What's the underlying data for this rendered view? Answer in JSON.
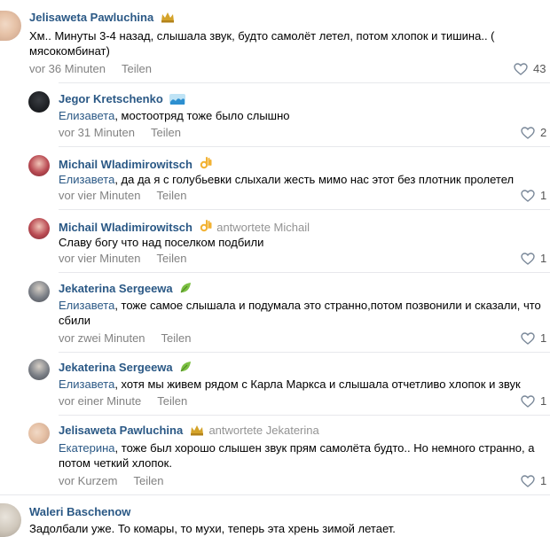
{
  "comments": [
    {
      "author": "Jelisaweta Pawluchina",
      "badge_icon": "crown-icon",
      "text": "Хм.. Минуты 3-4 назад, слышала звук, будто самолёт летел, потом хлопок и тишина.. ( мясокомбинат)",
      "time": "vor 36 Minuten",
      "share": "Teilen",
      "likes": "43"
    },
    {
      "author": "Jegor Kretschenko",
      "badge_icon": "wave-icon",
      "mention": "Елизавета",
      "text": ", мостоотряд тоже было слышно",
      "time": "vor 31 Minuten",
      "share": "Teilen",
      "likes": "2"
    },
    {
      "author": "Michail Wladimirowitsch",
      "badge_icon": "ok-hand-icon",
      "mention": "Елизавета",
      "text": ", да да я с голубьевки слыхали жесть мимо нас этот без плотник пролетел",
      "time": "vor vier Minuten",
      "share": "Teilen",
      "likes": "1"
    },
    {
      "author": "Michail Wladimirowitsch",
      "badge_icon": "ok-hand-icon",
      "reply_note": "antwortete Michail",
      "text": "Славу богу что над поселком подбили",
      "time": "vor vier Minuten",
      "share": "Teilen",
      "likes": "1"
    },
    {
      "author": "Jekaterina Sergeewa",
      "badge_icon": "leaf-icon",
      "mention": "Елизавета",
      "text": ", тоже самое слышала и подумала это странно,потом позвонили и сказали, что сбили",
      "time": "vor zwei Minuten",
      "share": "Teilen",
      "likes": "1"
    },
    {
      "author": "Jekaterina Sergeewa",
      "badge_icon": "leaf-icon",
      "mention": "Елизавета",
      "text": ", хотя мы живем рядом с Карла Маркса и слышала отчетливо хлопок и звук",
      "time": "vor einer Minute",
      "share": "Teilen",
      "likes": "1"
    },
    {
      "author": "Jelisaweta Pawluchina",
      "badge_icon": "crown-icon",
      "reply_note": "antwortete Jekaterina",
      "mention": "Екатерина",
      "text": ", тоже был хорошо слышен звук прям самолёта будто.. Но немного странно, а потом четкий хлопок.",
      "time": "vor Kurzem",
      "share": "Teilen",
      "likes": "1"
    },
    {
      "author": "Waleri Baschenow",
      "text": "Задолбали уже. То комары, то мухи, теперь эта хрень зимой летает."
    }
  ],
  "colors": {
    "link": "#2a5885",
    "meta": "#828282",
    "divider": "#e7e8ec"
  }
}
